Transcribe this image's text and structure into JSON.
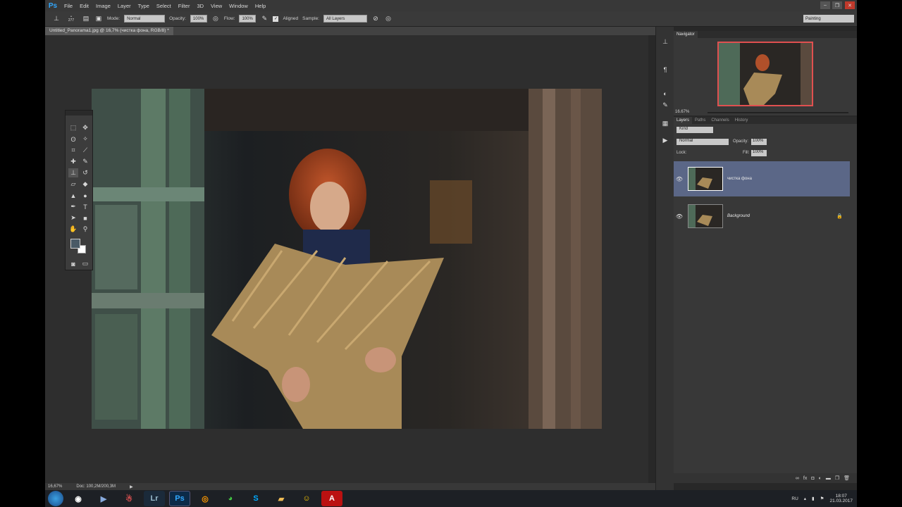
{
  "app": {
    "logo": "Ps"
  },
  "menu": [
    "File",
    "Edit",
    "Image",
    "Layer",
    "Type",
    "Select",
    "Filter",
    "3D",
    "View",
    "Window",
    "Help"
  ],
  "options": {
    "brush_size": "277",
    "mode_label": "Mode:",
    "mode_value": "Normal",
    "opacity_label": "Opacity:",
    "opacity_value": "100%",
    "flow_label": "Flow:",
    "flow_value": "100%",
    "aligned_label": "Aligned",
    "sample_label": "Sample:",
    "sample_value": "All Layers",
    "workspace": "Painting"
  },
  "document": {
    "tab_title": "Untitled_Panorama1.jpg @ 16,7% (чистка фона, RGB/8) *",
    "zoom": "16,67%",
    "doc_size": "Doc: 100,2M/200,3M"
  },
  "navigator": {
    "title": "Navigator",
    "zoom": "16.67%"
  },
  "layers_panel": {
    "tabs": [
      "Layers",
      "Paths",
      "Channels",
      "History"
    ],
    "kind": "Kind",
    "blend": "Normal",
    "opacity_label": "Opacity:",
    "opacity_value": "100%",
    "lock_label": "Lock:",
    "fill_label": "Fill:",
    "fill_value": "100%",
    "layers": [
      {
        "name": "чистка фона",
        "selected": true
      },
      {
        "name": "Background",
        "selected": false
      }
    ]
  },
  "taskbar": {
    "apps": [
      "start-orb",
      "steam",
      "media",
      "people",
      "Lr",
      "Ps",
      "eye",
      "chrome",
      "skype",
      "folder",
      "emoji",
      "acrobat"
    ],
    "lang": "RU",
    "time": "18:07",
    "date": "21.03.2017"
  },
  "colors": {
    "accent_selected": "#5b6787",
    "ps_blue": "#31a8ff"
  }
}
